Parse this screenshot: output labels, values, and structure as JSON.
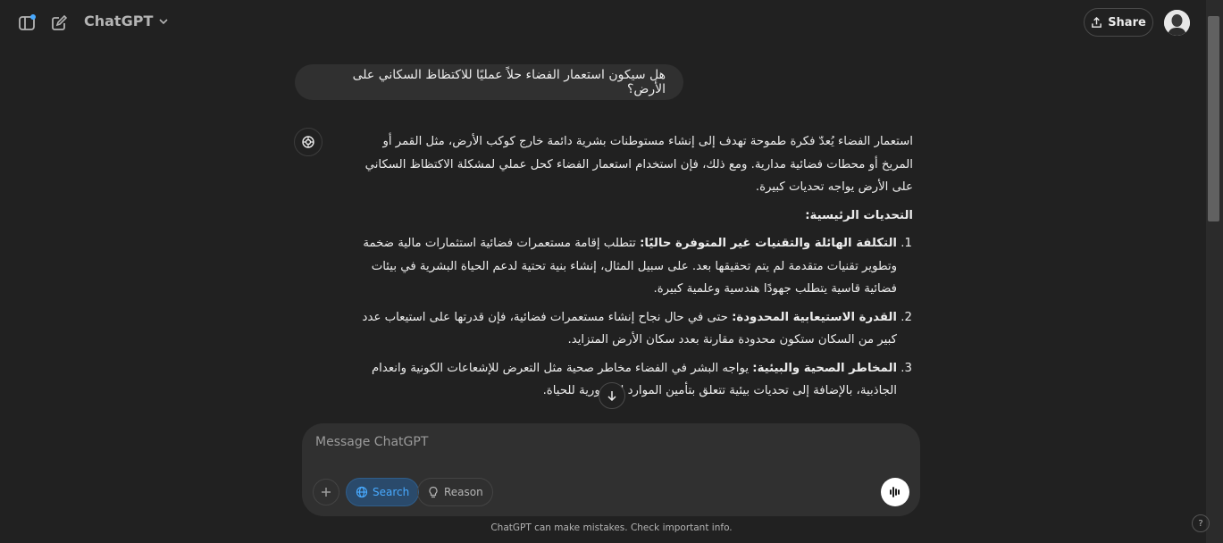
{
  "header": {
    "model_name": "ChatGPT",
    "share_label": "Share"
  },
  "conversation": {
    "user_message": "هل سيكون استعمار الفضاء حلاً عمليًا للاكتظاظ السكاني على الأرض؟",
    "intro": "استعمار الفضاء يُعدّ فكرة طموحة تهدف إلى إنشاء مستوطنات بشرية دائمة خارج كوكب الأرض، مثل القمر أو المريخ أو محطات فضائية مدارية. ومع ذلك، فإن استخدام استعمار الفضاء كحل عملي لمشكلة الاكتظاظ السكاني على الأرض يواجه تحديات كبيرة.",
    "heading": "التحديات الرئيسية:",
    "items": [
      {
        "title": "التكلفة الهائلة والتقنيات غير المتوفرة حاليًا:",
        "text": " تتطلب إقامة مستعمرات فضائية استثمارات مالية ضخمة وتطوير تقنيات متقدمة لم يتم تحقيقها بعد. على سبيل المثال، إنشاء بنية تحتية لدعم الحياة البشرية في بيئات فضائية قاسية يتطلب جهودًا هندسية وعلمية كبيرة."
      },
      {
        "title": "القدرة الاستيعابية المحدودة:",
        "text": " حتى في حال نجاح إنشاء مستعمرات فضائية، فإن قدرتها على استيعاب عدد كبير من السكان ستكون محدودة مقارنة بعدد سكان الأرض المتزايد."
      },
      {
        "title": "المخاطر الصحية والبيئية:",
        "text": " يواجه البشر في الفضاء مخاطر صحية مثل التعرض للإشعاعات الكونية وانعدام الجاذبية، بالإضافة إلى تحديات بيئية تتعلق بتأمين الموارد الضرورية للحياة."
      }
    ]
  },
  "composer": {
    "placeholder": "Message ChatGPT",
    "search_label": "Search",
    "reason_label": "Reason"
  },
  "footer": {
    "disclaimer": "ChatGPT can make mistakes. Check important info.",
    "help": "?"
  },
  "colors": {
    "background": "#212121",
    "bubble": "#303030",
    "accent": "#48aaff"
  }
}
